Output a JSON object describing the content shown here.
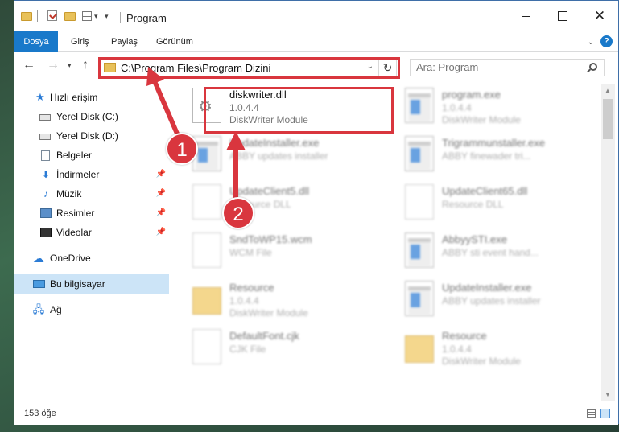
{
  "window": {
    "title": "Program",
    "close_glyph": "✕"
  },
  "ribbon": {
    "tabs": [
      "Dosya",
      "Giriş",
      "Paylaş",
      "Görünüm"
    ]
  },
  "address": {
    "path": "C:\\Program Files\\Program Dizini"
  },
  "search": {
    "placeholder": "Ara: Program"
  },
  "sidebar": {
    "items": [
      {
        "label": "Hızlı erişim",
        "icon": "star-icon"
      },
      {
        "label": "Yerel Disk (C:)",
        "icon": "drive-icon"
      },
      {
        "label": "Yerel Disk (D:)",
        "icon": "drive-icon"
      },
      {
        "label": "Belgeler",
        "icon": "documents-icon"
      },
      {
        "label": "İndirmeler",
        "icon": "download-icon",
        "pinned": true
      },
      {
        "label": "Müzik",
        "icon": "music-icon",
        "pinned": true
      },
      {
        "label": "Resimler",
        "icon": "pictures-icon",
        "pinned": true
      },
      {
        "label": "Videolar",
        "icon": "videos-icon",
        "pinned": true
      },
      {
        "label": "OneDrive",
        "icon": "cloud-icon"
      },
      {
        "label": "Bu bilgisayar",
        "icon": "computer-icon",
        "selected": true
      },
      {
        "label": "Ağ",
        "icon": "network-icon"
      }
    ]
  },
  "files": [
    {
      "name": "diskwriter.dll",
      "version": "1.0.4.4",
      "description": "DiskWriter Module",
      "type": "dll",
      "highlighted": true
    },
    {
      "name": "program.exe",
      "version": "1.0.4.4",
      "description": "DiskWriter Module",
      "type": "exe"
    },
    {
      "name": "UpdateInstaller.exe",
      "version": "",
      "description": "ABBY updates installer",
      "type": "exe"
    },
    {
      "name": "Trigrammunstaller.exe",
      "version": "",
      "description": "ABBY finewader tri...",
      "type": "exe"
    },
    {
      "name": "UpdateClient5.dll",
      "version": "",
      "description": "Resource DLL",
      "type": "doc"
    },
    {
      "name": "UpdateClient65.dll",
      "version": "",
      "description": "Resource DLL",
      "type": "doc"
    },
    {
      "name": "SndToWP15.wcm",
      "version": "",
      "description": "WCM File",
      "type": "doc"
    },
    {
      "name": "AbbyySTI.exe",
      "version": "",
      "description": "ABBY sti event hand...",
      "type": "exe"
    },
    {
      "name": "Resource",
      "version": "1.0.4.4",
      "description": "DiskWriter Module",
      "type": "folder"
    },
    {
      "name": "UpdateInstaller.exe",
      "version": "",
      "description": "ABBY updates installer",
      "type": "exe"
    },
    {
      "name": "DefaultFont.cjk",
      "version": "",
      "description": "CJK File",
      "type": "doc"
    },
    {
      "name": "Resource",
      "version": "1.0.4.4",
      "description": "DiskWriter Module",
      "type": "folder"
    }
  ],
  "annotations": {
    "step1": "1",
    "step2": "2",
    "color": "#d9363e"
  },
  "status": {
    "count": "153 öğe"
  },
  "colors": {
    "accent": "#1979ca",
    "selection": "#cce4f7",
    "highlight": "#d9363e"
  }
}
